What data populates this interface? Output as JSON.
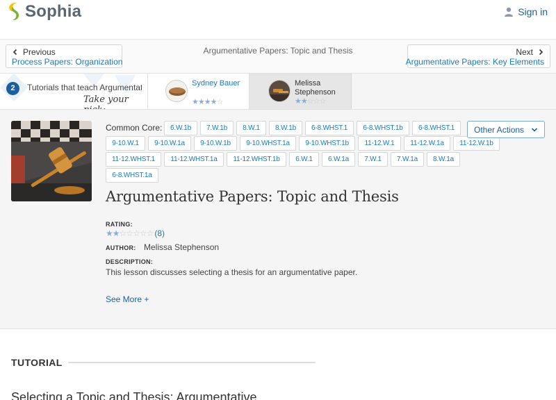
{
  "header": {
    "logo_text": "Sophia",
    "signin_label": "Sign in",
    "colors": {
      "logo_yellow": "#f5c400",
      "logo_green": "#79b33a",
      "link_blue": "#1a5f9e"
    }
  },
  "nav": {
    "prev_label": "Previous",
    "prev_title": "Process Papers: Organization",
    "center_title": "Argumentative Papers: Topic and Thesis",
    "next_label": "Next",
    "next_title": "Argumentative Papers: Key Elements"
  },
  "tutorials_bar": {
    "count": "2",
    "lead_text": "Tutorials that teach Argumentative Papers: Topic and Thesis",
    "pick_text": "Take your pick:",
    "tutors": [
      {
        "name": "Sydney Bauer",
        "rating": 4,
        "max": 5
      },
      {
        "name": "Melissa Stephenson",
        "rating": 2,
        "max": 5
      }
    ]
  },
  "lesson": {
    "common_core_label": "Common Core:",
    "tags": [
      "6.W.1b",
      "7.W.1b",
      "8.W.1",
      "8.W.1b",
      "6-8.WHST.1",
      "6-8.WHST.1b",
      "6-8.WHST.1",
      "9-10.W.1",
      "9-10.W.1a",
      "9-10.W.1b",
      "9-10.WHST.1a",
      "9-10.WHST.1b",
      "11-12.W.1",
      "11-12.W.1a",
      "11-12.W.1b",
      "11-12.WHST.1",
      "11-12.WHST.1a",
      "11-12.WHST.1b",
      "6.W.1",
      "6.W.1a",
      "7.W.1",
      "7.W.1a",
      "8.W.1a",
      "6-8.WHST.1a"
    ],
    "other_actions_label": "Other Actions",
    "title": "Argumentative Papers: Topic and Thesis",
    "rating_label": "RATING:",
    "rating_value": 2,
    "rating_max": 7,
    "rating_count": "(8)",
    "author_label": "AUTHOR:",
    "author": "Melissa Stephenson",
    "description_label": "DESCRIPTION:",
    "description": "This lesson discusses selecting a thesis for an argumentative paper.",
    "see_more_label": "See More +"
  },
  "tutorial_section": {
    "heading": "TUTORIAL",
    "lesson_title": "Selecting a Topic and Thesis: Argumentative"
  }
}
